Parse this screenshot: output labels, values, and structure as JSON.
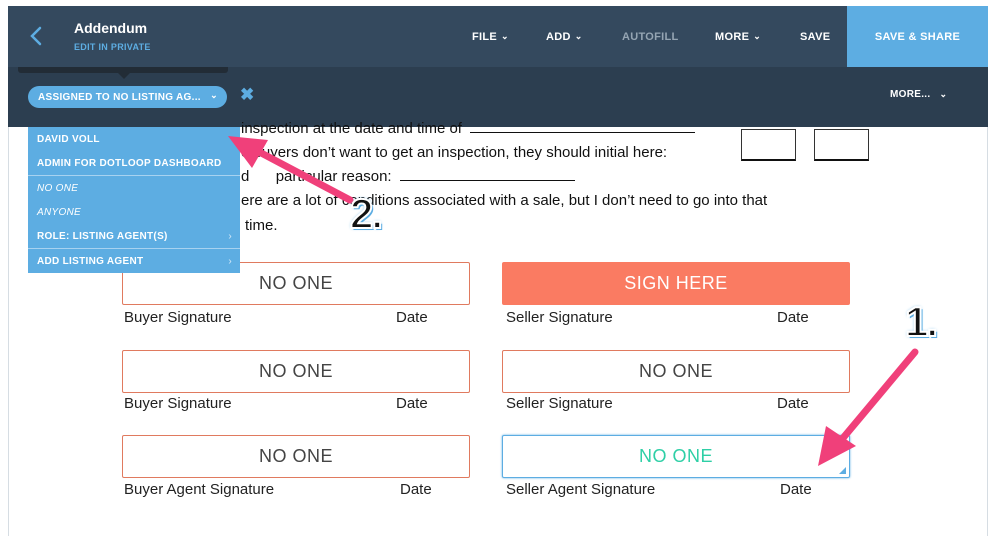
{
  "header": {
    "title": "Addendum",
    "subtitle": "EDIT IN PRIVATE",
    "nav": {
      "file": "FILE",
      "add": "ADD",
      "autofill": "AUTOFILL",
      "more": "MORE",
      "save": "SAVE",
      "save_share": "SAVE & SHARE"
    }
  },
  "filterbar": {
    "assigned_label": "ASSIGNED TO NO LISTING AG...",
    "more_label": "MORE..."
  },
  "dropdown": {
    "items": [
      {
        "label": "DAVID VOLL"
      },
      {
        "label": "ADMIN FOR DOTLOOP DASHBOARD"
      },
      {
        "label": "NO ONE"
      },
      {
        "label": "ANYONE"
      },
      {
        "label": "ROLE: LISTING AGENT(S)"
      },
      {
        "label": "ADD LISTING AGENT"
      }
    ]
  },
  "document": {
    "line1": "inspection at the date and time of",
    "line2": "e buyers don’t want to get an inspection, they should initial here:",
    "line3_a": "d",
    "line3_b": "particular reason:",
    "line4_a": "ere are a lot of",
    "line4_b": "conditions associated with a sale, but I don’t need to go into that",
    "line5": "time.",
    "fields": {
      "row1_left": "NO ONE",
      "row1_right": "SIGN HERE",
      "row2_left": "NO ONE",
      "row2_right": "NO ONE",
      "row3_left": "NO ONE",
      "row3_right": "NO ONE"
    },
    "labels": {
      "buyer_signature": "Buyer Signature",
      "seller_signature": "Seller Signature",
      "buyer_agent_signature": "Buyer Agent Signature",
      "seller_agent_signature": "Seller Agent Signature",
      "date": "Date"
    }
  },
  "annotations": {
    "badge1": "1.",
    "badge2": "2."
  },
  "colors": {
    "header_bg": "#34495e",
    "accent": "#5dade2",
    "sign_here": "#fa7b62",
    "arrow": "#f0407a"
  }
}
